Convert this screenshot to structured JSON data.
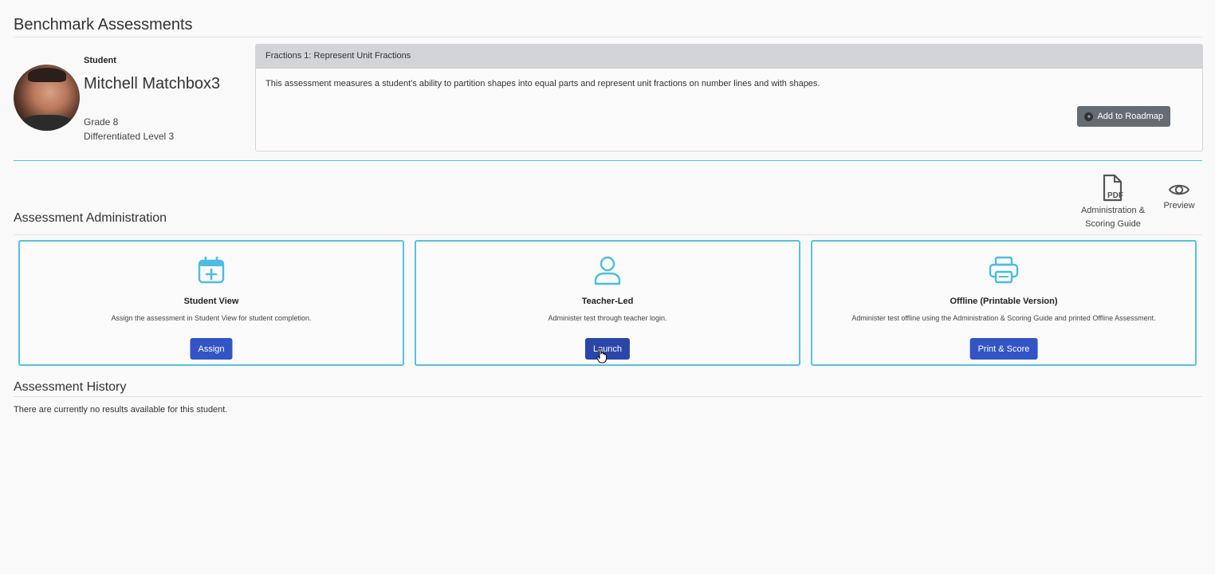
{
  "page": {
    "title": "Benchmark Assessments"
  },
  "student": {
    "label": "Student",
    "name": "Mitchell Matchbox3",
    "grade": "Grade 8",
    "level": "Differentiated Level 3"
  },
  "assessment": {
    "title": "Fractions 1: Represent Unit Fractions",
    "description": "This assessment measures a student's ability to partition shapes into equal parts and represent unit fractions on number lines and with shapes.",
    "roadmap_button": "Add to Roadmap"
  },
  "resources": {
    "pdf_label_line1": "Administration &",
    "pdf_label_line2": "Scoring Guide",
    "pdf_icon_text": "PDF",
    "preview_label": "Preview"
  },
  "administration": {
    "heading": "Assessment Administration",
    "cards": [
      {
        "icon": "calendar-plus-icon",
        "title": "Student View",
        "description": "Assign the assessment in Student View for student completion.",
        "button": "Assign"
      },
      {
        "icon": "user-icon",
        "title": "Teacher-Led",
        "description": "Administer test through teacher login.",
        "button": "Launch"
      },
      {
        "icon": "printer-icon",
        "title": "Offline (Printable Version)",
        "description": "Administer test offline using the Administration & Scoring Guide and printed Offline Assessment.",
        "button": "Print & Score"
      }
    ]
  },
  "history": {
    "heading": "Assessment History",
    "empty_message": "There are currently no results available for this student."
  },
  "colors": {
    "accent": "#55c3dc",
    "primary_button": "#3254c5",
    "secondary_button": "#666c74"
  }
}
